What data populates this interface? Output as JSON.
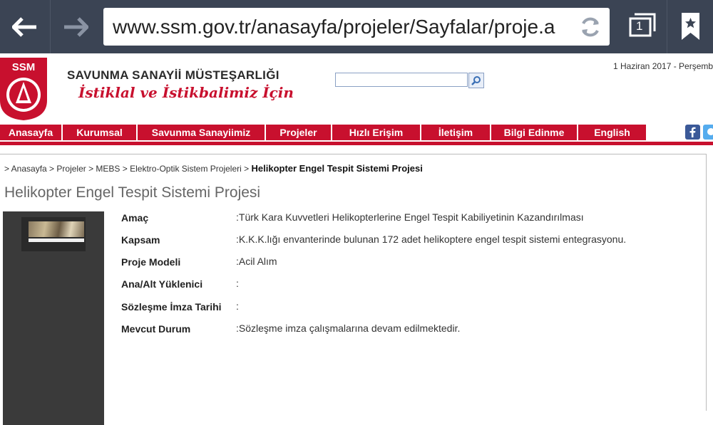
{
  "browser": {
    "url": "www.ssm.gov.tr/anasayfa/projeler/Sayfalar/proje.a",
    "tab_count": "1",
    "icons": [
      "back-arrow-icon",
      "forward-arrow-icon",
      "reload-icon",
      "tabs-icon",
      "bookmark-icon"
    ]
  },
  "header": {
    "logo_text": "SSM",
    "org_name": "SAVUNMA SANAYİİ MÜSTEŞARLIĞI",
    "motto": "İstiklal ve İstikbalimiz İçin",
    "date": "1 Haziran 2017 - Perşembe",
    "search_placeholder": ""
  },
  "nav": {
    "items": [
      {
        "label": "Anasayfa"
      },
      {
        "label": "Kurumsal"
      },
      {
        "label": "Savunma Sanayiimiz"
      },
      {
        "label": "Projeler"
      },
      {
        "label": "Hızlı Erişim"
      },
      {
        "label": "İletişim"
      },
      {
        "label": "Bilgi Edinme"
      },
      {
        "label": "English"
      }
    ]
  },
  "breadcrumb": {
    "path": "> Anasayfa > Projeler > MEBS > Elektro-Optik Sistem Projeleri >",
    "current": "Helikopter Engel Tespit Sistemi Projesi"
  },
  "page_title": "Helikopter Engel Tespit Sistemi Projesi",
  "details": [
    {
      "label": "Amaç",
      "value": ":Türk Kara Kuvvetleri Helikopterlerine Engel Tespit Kabiliyetinin Kazandırılması"
    },
    {
      "label": "Kapsam",
      "value": ":K.K.K.lığı envanterinde bulunan 172 adet helikoptere engel tespit sistemi entegrasyonu."
    },
    {
      "label": "Proje Modeli",
      "value": ":Acil Alım"
    },
    {
      "label": "Ana/Alt Yüklenici",
      "value": ":"
    },
    {
      "label": "Sözleşme İmza Tarihi",
      "value": ":"
    },
    {
      "label": "Mevcut Durum",
      "value": ":Sözleşme imza çalışmalarına devam edilmektedir."
    }
  ],
  "colors": {
    "chrome": "#3b4454",
    "brand_red": "#c8102e"
  }
}
